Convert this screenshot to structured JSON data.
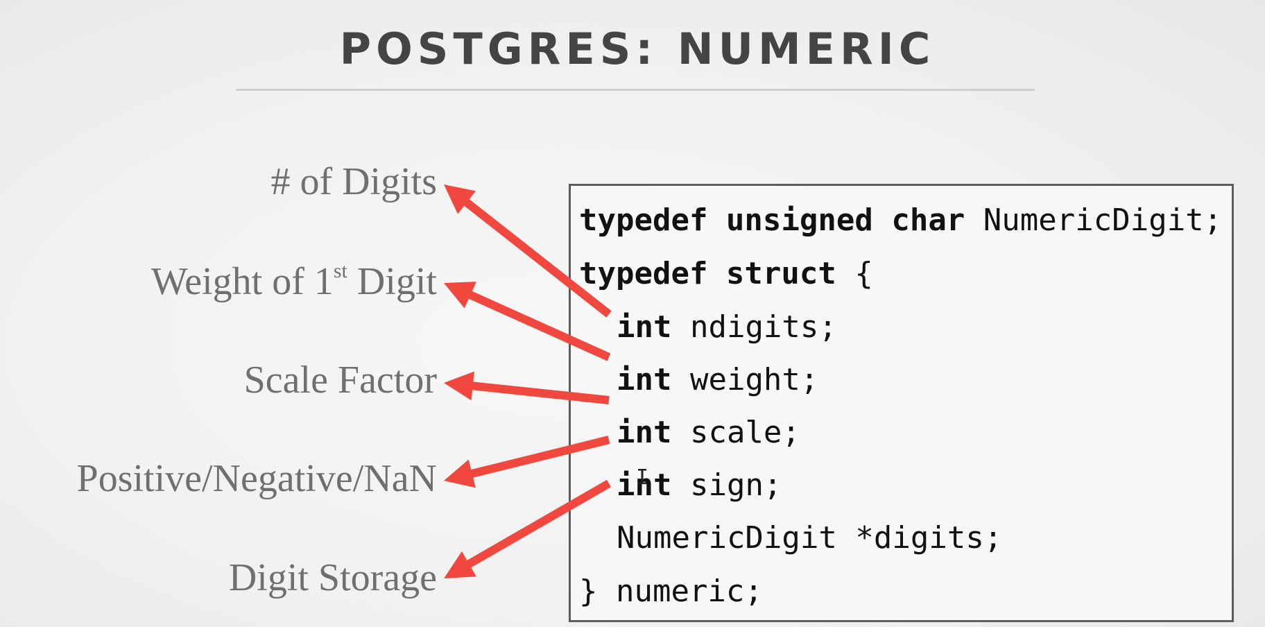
{
  "title": "POSTGRES: NUMERIC",
  "labels": [
    {
      "text": "# of Digits"
    },
    {
      "pre": "Weight of 1",
      "sup": "st",
      "post": " Digit"
    },
    {
      "text": "Scale Factor"
    },
    {
      "text": "Positive/Negative/NaN"
    },
    {
      "text": "Digit Storage"
    }
  ],
  "code": {
    "line1_kw": "typedef unsigned char",
    "line1_rest": " NumericDigit;",
    "line2_kw": "typedef struct",
    "line2_rest": " {",
    "line3_kw": "int",
    "line3_rest": " ndigits;",
    "line4_kw": "int",
    "line4_rest": " weight;",
    "line5_kw": "int",
    "line5_rest": " scale;",
    "line6_kw": "int",
    "line6_rest": " sign;",
    "line7": "NumericDigit *digits;",
    "line8": "} numeric;"
  },
  "colors": {
    "arrow": "#f0483e",
    "label": "#6f6f6f",
    "title": "#444444"
  },
  "icons": {
    "cursor": "text-cursor-icon"
  }
}
